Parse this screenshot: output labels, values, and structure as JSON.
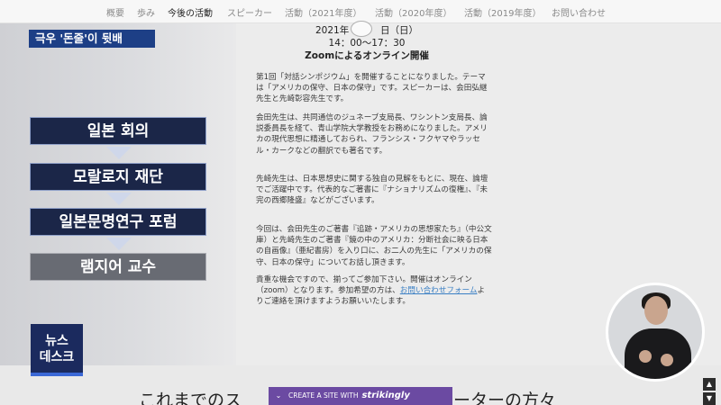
{
  "nav": {
    "items": [
      "概要",
      "歩み",
      "今後の活動",
      "スピーカー",
      "活動（2021年度）",
      "活動（2020年度）",
      "活動（2019年度）",
      "お問い合わせ"
    ],
    "active_index": 2
  },
  "headline": "극우 '돈줄'이 뒷배",
  "flow": {
    "items": [
      "일본 회의",
      "모랄로지 재단",
      "일본문명연구 포럼",
      "램지어 교수"
    ]
  },
  "newsdesk": {
    "line1": "뉴스",
    "line2": "데스크"
  },
  "content": {
    "date": "2021年 　　　日（日）",
    "time": "14：00〜17：30",
    "venue": "Zoomによるオンライン開催",
    "paragraphs": [
      "第1回「対話シンポジウム」を開催することになりました。テーマは「アメリカの保守、日本の保守」です。スピーカーは、会田弘継先生と先崎彰容先生です。",
      "会田先生は、共同通信のジュネーブ支局長、ワシントン支局長、論説委員長を経て、青山学院大学教授をお務めになりました。アメリカの現代思想に精通しておられ、フランシス・フクヤマやラッセル・カークなどの翻訳でも著名です。",
      "先崎先生は、日本思想史に関する独自の見解をもとに、現在、論壇でご活躍中です。代表的なご著書に『ナショナリズムの復権』、『未完の西郷隆盛』などがございます。",
      "今回は、会田先生のご著書『追跡・アメリカの思想家たち』（中公文庫）と先崎先生のご著書『鏡の中のアメリカ：分断社会に映る日本の自画像』（亜紀書房）を入り口に、お二人の先生に「アメリカの保守、日本の保守」についてお話し頂きます。"
    ],
    "last_para_before_link": "貴重な機会ですので、揃ってご参加下さい。開催はオンライン（zoom）となります。参加希望の方は、",
    "link_text": "お問い合わせフォーム",
    "last_para_after_link": "よりご連絡を頂けますようお願いいたします。"
  },
  "bottom": {
    "caption_left": "これまでのス",
    "caption_right": "ーターの方々",
    "banner_chevron": "⌄",
    "banner_label": "CREATE A SITE WITH",
    "banner_brand": "strikingly"
  },
  "scroll": {
    "up": "▲",
    "down": "▼"
  },
  "colors": {
    "headline_bg": "#1d3f86",
    "flow_box_bg": "#1b2648",
    "flow_last_bg": "#686b73",
    "newsdesk_bg": "#1b2a5e",
    "banner_bg": "#6b4aa2",
    "link": "#3a7fc4"
  }
}
